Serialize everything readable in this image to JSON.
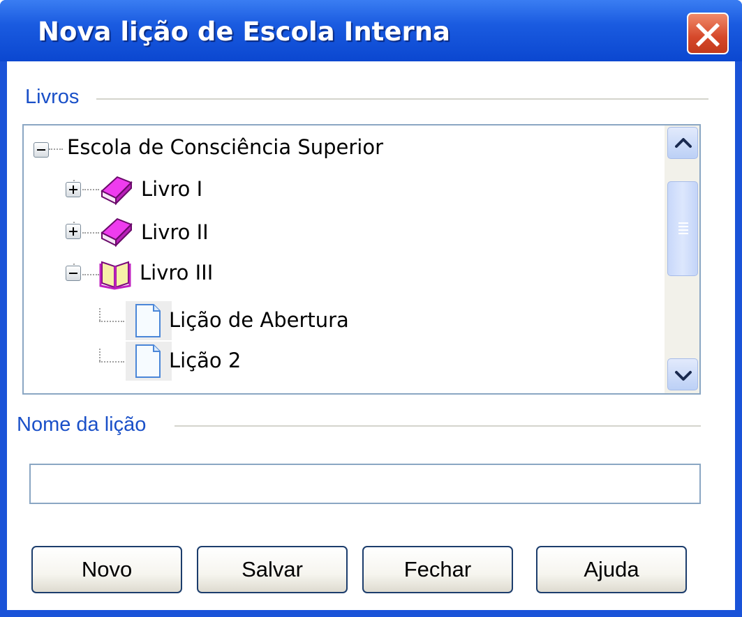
{
  "window": {
    "title": "Nova lição de Escola Interna",
    "close_icon": "close-icon"
  },
  "books_group": {
    "label": "Livros"
  },
  "tree": {
    "root": {
      "label": "Escola de Consciência Superior",
      "expanded": true
    },
    "items": [
      {
        "label": "Livro I",
        "icon": "closed-book-icon",
        "expanded": false
      },
      {
        "label": "Livro II",
        "icon": "closed-book-icon",
        "expanded": false
      },
      {
        "label": "Livro III",
        "icon": "open-book-icon",
        "expanded": true,
        "children": [
          {
            "label": "Lição de Abertura",
            "icon": "document-icon"
          },
          {
            "label": "Lição 2",
            "icon": "document-icon"
          }
        ]
      }
    ]
  },
  "lesson_name": {
    "label": "Nome da lição",
    "value": ""
  },
  "buttons": {
    "new": "Novo",
    "save": "Salvar",
    "close": "Fechar",
    "help": "Ajuda"
  },
  "colors": {
    "titlebar": "#1a5be0",
    "group_label": "#1a50c8",
    "close_button": "#d5482a",
    "book_closed": "#e020e0"
  }
}
